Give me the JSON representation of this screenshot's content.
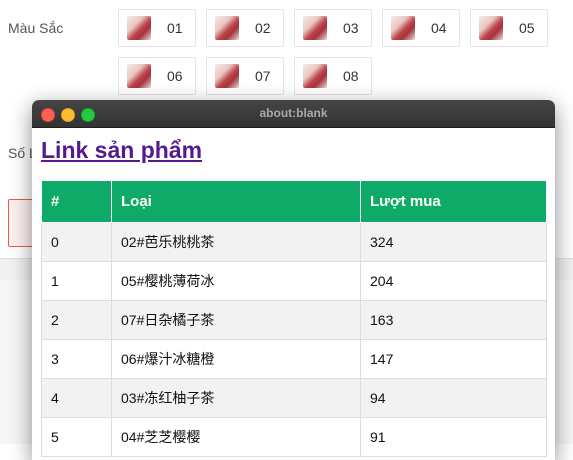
{
  "page": {
    "color_label": "Màu Sắc",
    "qty_label": "Số L",
    "swatches": [
      "01",
      "02",
      "03",
      "04",
      "05",
      "06",
      "07",
      "08"
    ]
  },
  "window": {
    "title": "about:blank"
  },
  "content": {
    "link_title": "Link sản phẩm",
    "table": {
      "headers": [
        "#",
        "Loại",
        "Lượt mua"
      ],
      "rows": [
        [
          "0",
          "02#芭乐桃桃茶",
          "324"
        ],
        [
          "1",
          "05#樱桃薄荷冰",
          "204"
        ],
        [
          "2",
          "07#日杂橘子茶",
          "163"
        ],
        [
          "3",
          "06#爆汁冰糖橙",
          "147"
        ],
        [
          "4",
          "03#冻红柚子茶",
          "94"
        ],
        [
          "5",
          "04#芝芝樱樱",
          "91"
        ]
      ]
    }
  }
}
